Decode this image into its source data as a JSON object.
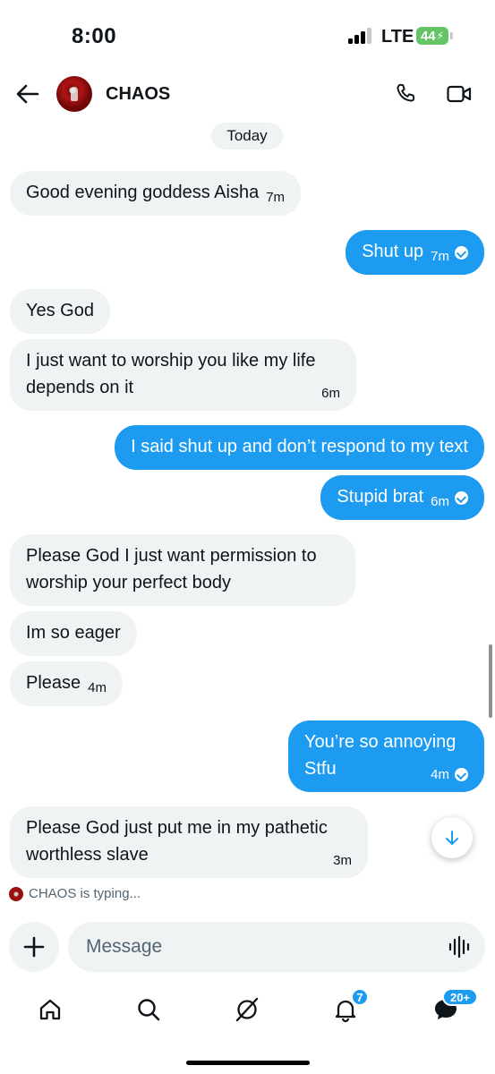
{
  "status_bar": {
    "time": "8:00",
    "network": "LTE",
    "battery": "44"
  },
  "header": {
    "contact_name": "CHAOS",
    "icons": [
      "back-arrow-icon",
      "phone-icon",
      "video-camera-icon"
    ]
  },
  "date_separator": "Today",
  "messages": [
    {
      "direction": "in",
      "text": "Good evening goddess Aisha",
      "time": "7m"
    },
    {
      "direction": "out",
      "text": "Shut up",
      "time": "7m",
      "read": true
    },
    {
      "direction": "in",
      "text": "Yes God",
      "time": ""
    },
    {
      "direction": "in",
      "text_line1": "I just want to worship you like my life",
      "text_line2": "depends on it",
      "time": "6m"
    },
    {
      "direction": "out",
      "text": "I said shut up and don’t respond to my text",
      "time": ""
    },
    {
      "direction": "out",
      "text": "Stupid brat",
      "time": "6m",
      "read": true
    },
    {
      "direction": "in",
      "text_line1": "Please God I just want permission to",
      "text_line2": "worship your perfect body",
      "time": ""
    },
    {
      "direction": "in",
      "text": "Im so eager",
      "time": ""
    },
    {
      "direction": "in",
      "text": "Please",
      "time": "4m"
    },
    {
      "direction": "out",
      "text_line1": "You’re so annoying",
      "text_line2": "Stfu",
      "time": "4m",
      "read": true
    },
    {
      "direction": "in",
      "text_line1": "Please God just put me in my pathetic",
      "text_line2": "worthless slave",
      "time": "3m"
    }
  ],
  "typing_indicator": "CHAOS is typing...",
  "composer": {
    "placeholder": "Message"
  },
  "tabbar": {
    "notifications_badge": "7",
    "messages_badge": "20+"
  },
  "colors": {
    "accent": "#1d9bf0",
    "incoming_bubble": "#eff3f4",
    "text": "#0f1419"
  }
}
